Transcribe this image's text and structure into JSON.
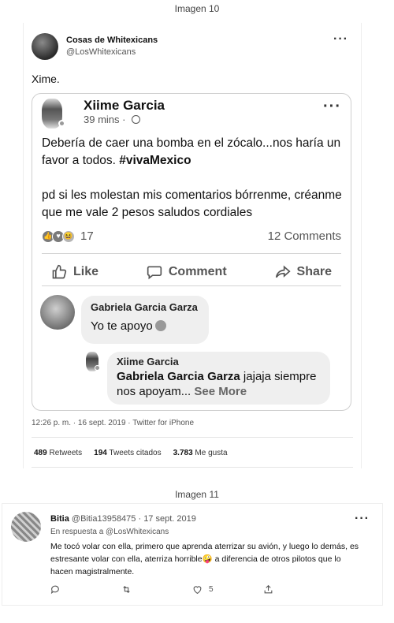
{
  "captions": {
    "first": "Imagen 10",
    "second": "Imagen 11"
  },
  "tweet1": {
    "name": "Cosas de Whitexicans",
    "handle": "@LosWhitexicans",
    "text": "Xime.",
    "timestamp": "12:26 p. m. · 16 sept. 2019 · Twitter for iPhone",
    "stats": {
      "retweets": "489",
      "retweets_label": "Retweets",
      "quotes": "194",
      "quotes_label": "Tweets citados",
      "likes": "3.783",
      "likes_label": "Me gusta"
    }
  },
  "fb_post": {
    "author": "Xiime Garcia",
    "time": "39 mins · ",
    "body_line1": "Debería de caer una bomba en el zócalo...nos haría un favor a todos. ",
    "hashtag": "#vivaMexico",
    "body_line2": "pd si les molestan mis comentarios bórrenme, créanme que me vale 2 pesos  saludos cordiales",
    "reaction_count": "17",
    "comments_count": "12 Comments",
    "actions": {
      "like": "Like",
      "comment": "Comment",
      "share": "Share"
    },
    "comments": [
      {
        "name": "Gabriela Garcia Garza",
        "text": "Yo te apoyo"
      },
      {
        "name": "Xiime Garcia",
        "mention": "Gabriela Garcia Garza",
        "text": " jajaja siempre nos apoyam...",
        "see_more": " See More"
      }
    ]
  },
  "tweet2": {
    "name": "Bitia",
    "handle_date": "@Bitia13958475 · 17 sept. 2019",
    "reply_to": "En respuesta a @LosWhitexicans",
    "text_before_emoji": "Me tocó volar con ella, primero que aprenda aterrizar su avión, y luego lo demás, es estresante  volar con ella, aterriza horrible",
    "emoji": "🤪",
    "text_after_emoji": " a diferencia de otros pilotos que lo hacen magistralmente.",
    "like_count": "5"
  },
  "colors": {
    "text": "#111111",
    "muted": "#555555",
    "bubble": "#efefef",
    "divider": "#d4d4d4"
  }
}
